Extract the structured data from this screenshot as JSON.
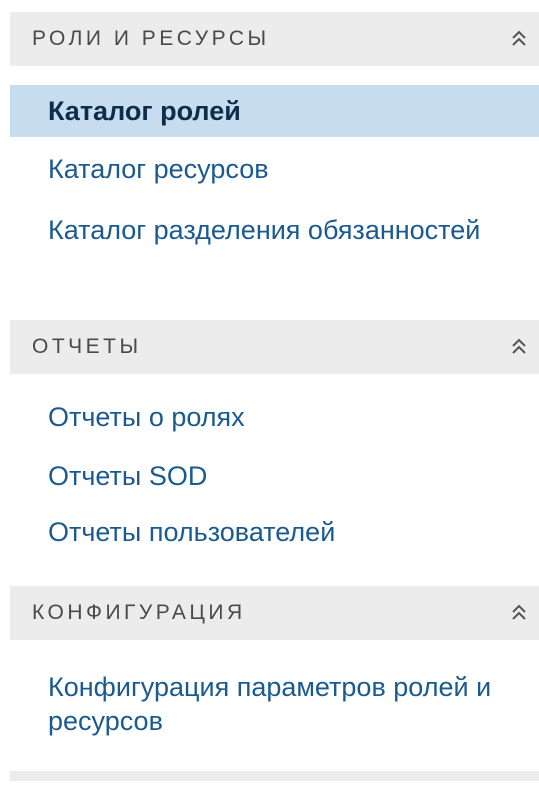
{
  "sections": [
    {
      "title": "РОЛИ И РЕСУРСЫ",
      "icon": "double-chevron-up-icon",
      "items": [
        {
          "label": "Каталог ролей",
          "selected": true
        },
        {
          "label": "Каталог ресурсов",
          "selected": false
        },
        {
          "label": "Каталог разделения обязанностей",
          "selected": false
        }
      ]
    },
    {
      "title": "ОТЧЕТЫ",
      "icon": "double-chevron-up-icon",
      "items": [
        {
          "label": "Отчеты о ролях",
          "selected": false
        },
        {
          "label": "Отчеты SOD",
          "selected": false
        },
        {
          "label": "Отчеты пользователей",
          "selected": false
        }
      ]
    },
    {
      "title": "КОНФИГУРАЦИЯ",
      "icon": "double-chevron-up-icon",
      "items": [
        {
          "label": "Конфигурация параметров ролей и ресурсов",
          "selected": false
        }
      ]
    }
  ],
  "colors": {
    "header_bg": "#ececec",
    "selected_bg": "#c8dcf0",
    "link": "#1b5a91",
    "selected_text": "#0d2e4a",
    "header_text": "#4a4a4a"
  }
}
